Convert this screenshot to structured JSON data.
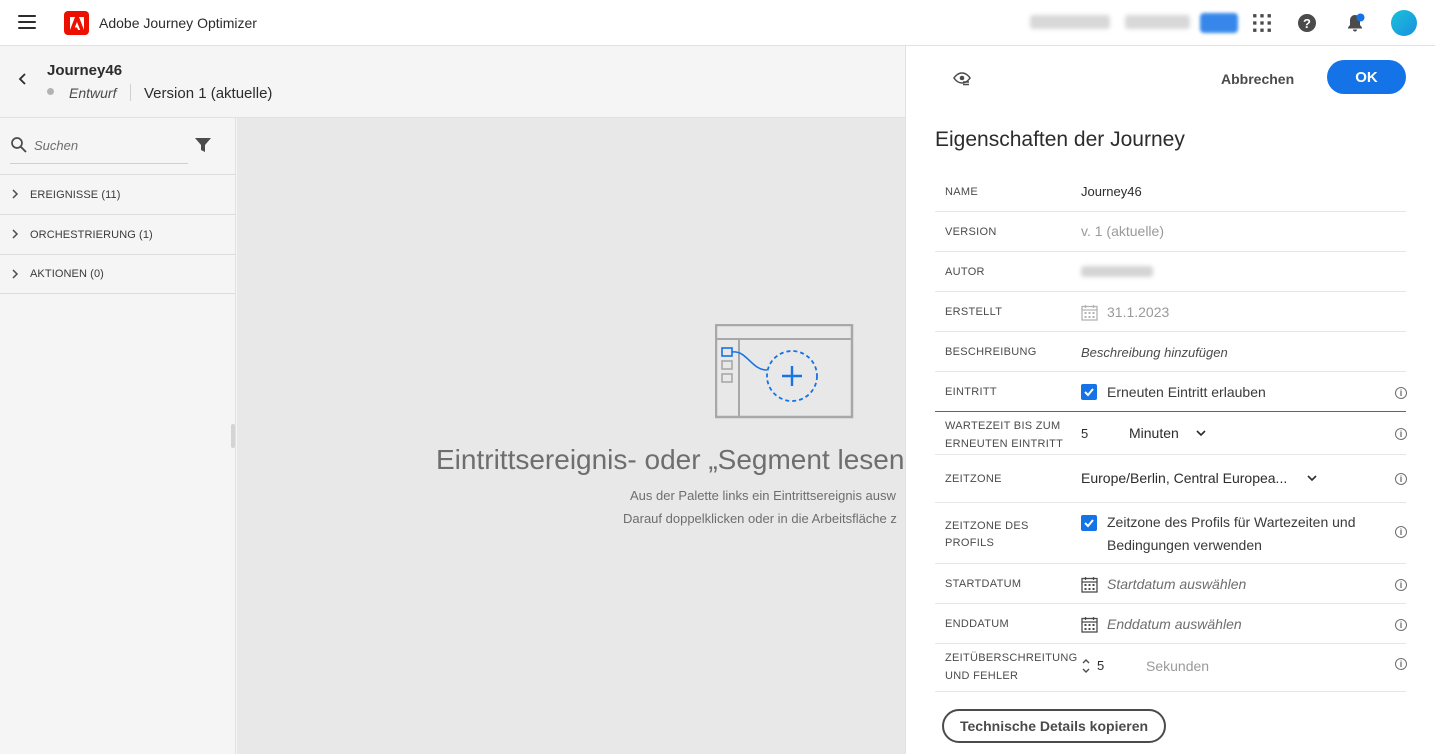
{
  "app": {
    "title": "Adobe Journey Optimizer"
  },
  "topbar": {
    "icons": [
      "menu-icon",
      "apps-grid-icon",
      "help-icon",
      "bell-icon",
      "avatar"
    ],
    "help_glyph": "?"
  },
  "journey": {
    "name": "Journey46",
    "status": "Entwurf",
    "version": "Version 1 (aktuelle)"
  },
  "palette": {
    "search_placeholder": "Suchen",
    "categories": [
      {
        "label": "EREIGNISSE (11)"
      },
      {
        "label": "ORCHESTRIERUNG (1)"
      },
      {
        "label": "AKTIONEN (0)"
      }
    ]
  },
  "canvas": {
    "title": "Eintrittsereignis- oder „Segment lesen“-A",
    "line1": "Aus der Palette links ein Eintrittsereignis ausw",
    "line2": "Darauf doppelklicken oder in die Arbeitsfläche z"
  },
  "panel": {
    "cancel": "Abbrechen",
    "ok": "OK",
    "title": "Eigenschaften der Journey",
    "props": {
      "name": {
        "label": "NAME",
        "value": "Journey46"
      },
      "version": {
        "label": "VERSION",
        "value": "v. 1 (aktuelle)"
      },
      "author": {
        "label": "AUTOR"
      },
      "created": {
        "label": "ERSTELLT",
        "value": "31.1.2023"
      },
      "description": {
        "label": "BESCHREIBUNG",
        "placeholder": "Beschreibung hinzufügen"
      },
      "entry": {
        "label": "EINTRITT",
        "checkbox_label": "Erneuten Eintritt erlauben",
        "checked": true
      },
      "wait": {
        "label_line1": "WARTEZEIT BIS ZUM",
        "label_line2": "ERNEUTEN EINTRITT",
        "value": "5",
        "unit": "Minuten"
      },
      "timezone": {
        "label": "ZEITZONE",
        "value": "Europe/Berlin, Central Europea..."
      },
      "profile_tz": {
        "label_line1": "ZEITZONE DES",
        "label_line2": "PROFILS",
        "checkbox_line1": "Zeitzone des Profils für Wartezeiten und",
        "checkbox_line2": "Bedingungen verwenden",
        "checked": true
      },
      "start": {
        "label": "STARTDATUM",
        "placeholder": "Startdatum auswählen"
      },
      "end": {
        "label": "ENDDATUM",
        "placeholder": "Enddatum auswählen"
      },
      "timeout": {
        "label_line1": "ZEITÜBERSCHREITUNG",
        "label_line2": "UND FEHLER",
        "value": "5",
        "unit": "Sekunden"
      }
    },
    "copy_button": "Technische Details kopieren",
    "info_glyph": "i"
  },
  "colors": {
    "accent": "#1473e6",
    "adobe_red": "#eb1000"
  }
}
